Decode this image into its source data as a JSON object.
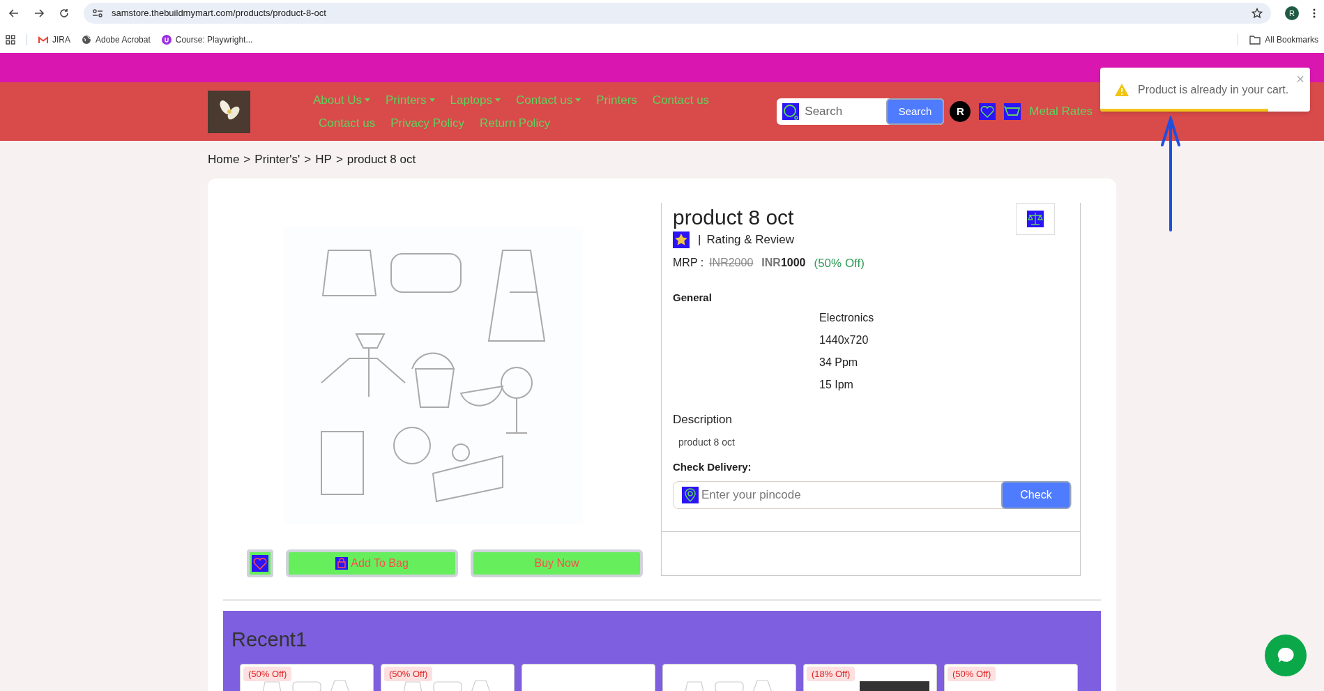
{
  "browser": {
    "url": "samstore.thebuildmymart.com/products/product-8-oct",
    "profile_initial": "R",
    "bookmarks": [
      {
        "label": "JIRA",
        "kind": "mail"
      },
      {
        "label": "Adobe Acrobat",
        "kind": "globe"
      },
      {
        "label": "Course: Playwright...",
        "kind": "course"
      }
    ],
    "all_bookmarks": "All Bookmarks"
  },
  "header": {
    "nav_rows": [
      [
        {
          "label": "About Us",
          "dropdown": true
        },
        {
          "label": "Printers",
          "dropdown": true
        },
        {
          "label": "Laptops",
          "dropdown": true
        },
        {
          "label": "Contact us",
          "dropdown": true
        },
        {
          "label": "Printers",
          "dropdown": false
        },
        {
          "label": "Contact us",
          "dropdown": false
        }
      ],
      [
        {
          "label": "Contact us",
          "dropdown": false
        },
        {
          "label": "Privacy Policy",
          "dropdown": false
        },
        {
          "label": "Return Policy",
          "dropdown": false
        }
      ]
    ],
    "search": {
      "placeholder": "Search",
      "button": "Search"
    },
    "user_initial": "R",
    "metal_rates": "Metal Rates"
  },
  "toast": {
    "message": "Product is already in your cart.",
    "close": "×",
    "level": 0.8
  },
  "breadcrumb": {
    "separator": ">",
    "items": [
      "Home",
      "Printer's'",
      "HP",
      "product 8 oct"
    ]
  },
  "product": {
    "title": "product 8 oct",
    "rating_separator": "|",
    "rating_label": "Rating & Review",
    "mrp_label": "MRP :",
    "old_price": "INR2000",
    "currency": "INR",
    "price": "1000",
    "discount": "(50% Off)",
    "general_heading": "General",
    "specs": [
      "Electronics",
      "1440x720",
      "34 Ppm",
      "15 Ipm"
    ],
    "description_heading": "Description",
    "description": "product 8 oct",
    "delivery_label": "Check Delivery:",
    "pincode_placeholder": "Enter your pincode",
    "check_button": "Check",
    "add_to_bag": "Add To Bag",
    "buy_now": "Buy Now"
  },
  "recent": {
    "title": "Recent1",
    "cards": [
      {
        "badge": "(50% Off)",
        "kind": "sketch"
      },
      {
        "badge": "(50% Off)",
        "kind": "sketch"
      },
      {
        "kind": "blank"
      },
      {
        "kind": "sketch"
      },
      {
        "badge": "(18% Off)",
        "kind": "photo"
      },
      {
        "badge": "(50% Off)",
        "kind": "blank"
      }
    ]
  }
}
